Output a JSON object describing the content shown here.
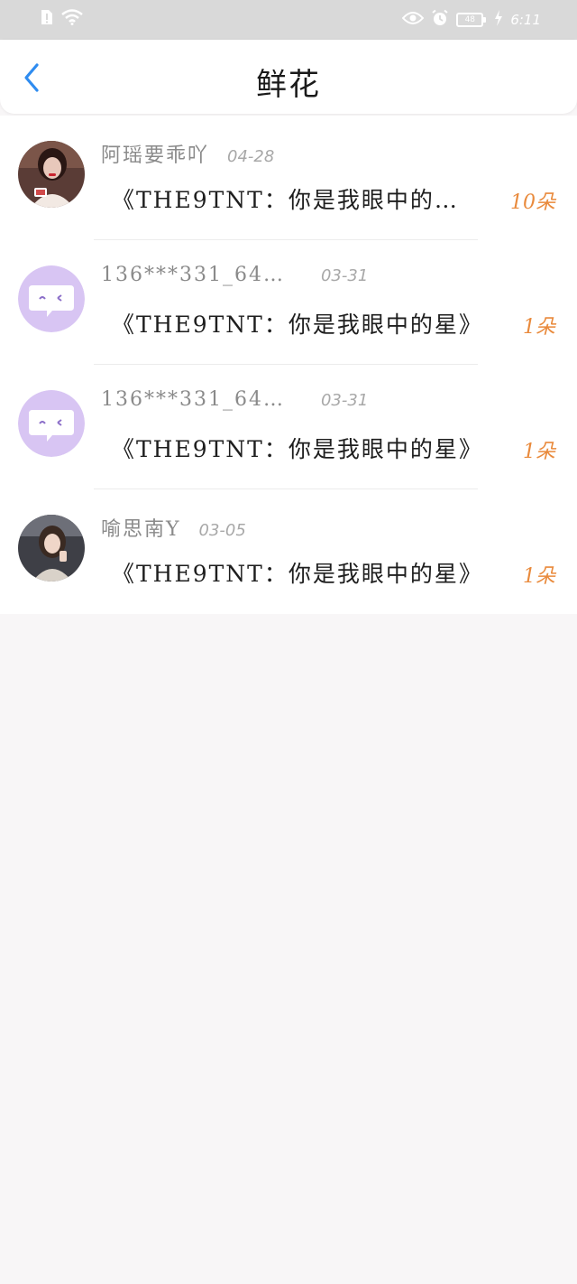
{
  "status_bar": {
    "time": "6:11",
    "battery": "48",
    "icons": [
      "alert-icon",
      "wifi-icon",
      "eye-icon",
      "alarm-icon",
      "battery-icon",
      "charging-icon"
    ]
  },
  "header": {
    "title": "鲜花",
    "back_icon": "chevron-left-icon"
  },
  "colors": {
    "accent": "#2f8cf0",
    "count": "#e98a3c",
    "background": "#f8f6f7"
  },
  "items": [
    {
      "username": "阿瑶要乖吖",
      "date": "04-28",
      "message": "《THE9TNT：你是我眼中的…",
      "count": "10朵"
    },
    {
      "username": "136***331_64…",
      "date": "03-31",
      "message": "《THE9TNT：你是我眼中的星》",
      "count": "1朵"
    },
    {
      "username": "136***331_64…",
      "date": "03-31",
      "message": "《THE9TNT：你是我眼中的星》",
      "count": "1朵"
    },
    {
      "username": "喻思南Y",
      "date": "03-05",
      "message": "《THE9TNT：你是我眼中的星》",
      "count": "1朵"
    }
  ]
}
